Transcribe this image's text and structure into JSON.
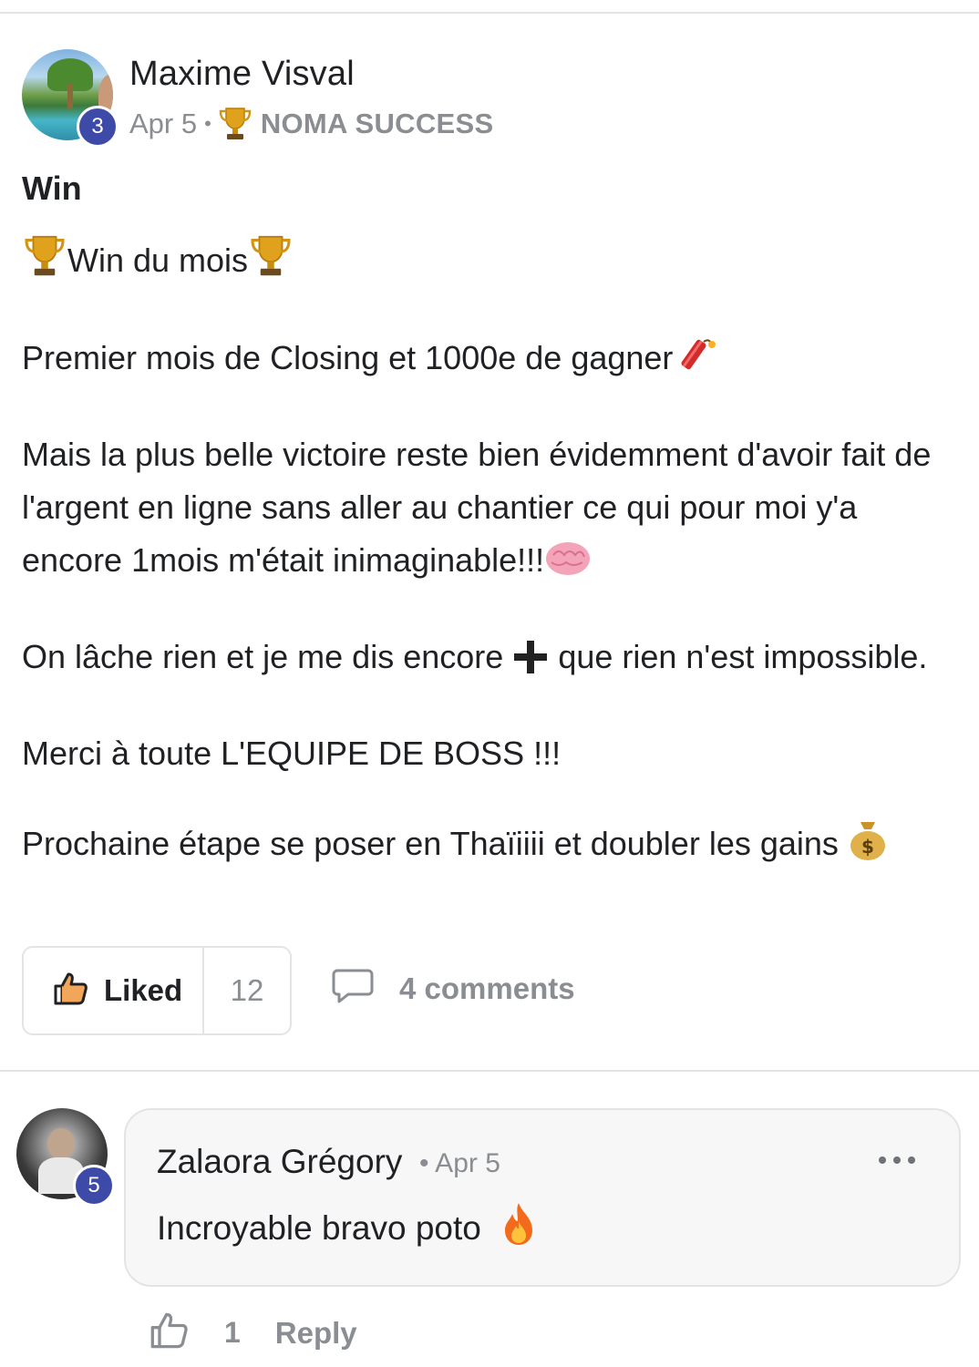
{
  "post": {
    "author": {
      "name": "Maxime Visval",
      "level": "3"
    },
    "date": "Apr 5",
    "separator": "•",
    "category": "NOMA SUCCESS",
    "title": "Win",
    "body": {
      "headline": "Win du mois",
      "p1": "Premier mois de Closing et 1000e de gagner",
      "p2": "Mais la plus belle victoire reste bien évidemment d'avoir fait de l'argent en ligne sans aller au chantier ce qui pour moi y'a encore 1mois m'était inimaginable!!!",
      "p3a": "On lâche rien et je me dis encore",
      "p3b": "que rien n'est impossible.",
      "p4": "Merci à toute L'EQUIPE DE BOSS !!!",
      "p5": "Prochaine étape se poser en Thaïiiii et doubler les gains"
    },
    "actions": {
      "like_label": "Liked",
      "like_count": "12",
      "comments_label": "4 comments"
    }
  },
  "comments": [
    {
      "author": "Zalaora Grégory",
      "level": "5",
      "meta": "• Apr 5",
      "text": "Incroyable bravo poto",
      "like_count": "1",
      "reply_label": "Reply"
    }
  ],
  "icons": {
    "trophy": "trophy-icon",
    "firecracker": "firecracker-icon",
    "brain": "brain-icon",
    "plus": "plus-icon",
    "money_bag": "money-bag-icon",
    "fire": "fire-icon",
    "thumbs_up": "thumbs-up-icon",
    "comment": "comment-bubble-icon",
    "more": "more-options-icon"
  },
  "colors": {
    "badge": "#3e4aa8",
    "muted_text": "#8a8d91",
    "text": "#202124",
    "divider": "#e4e4e4",
    "bubble_bg": "#f7f7f8"
  }
}
